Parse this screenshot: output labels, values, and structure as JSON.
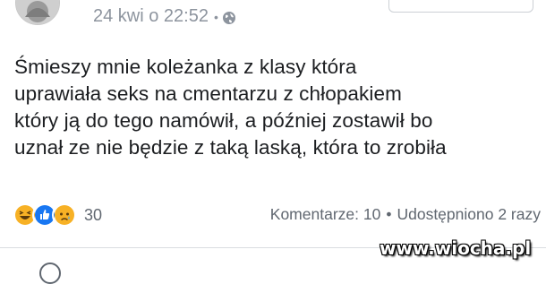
{
  "post": {
    "timestamp": "24 kwi o 22:52",
    "separator": "•",
    "privacy_icon": "globe-icon",
    "text": "Śmieszy mnie koleżanka z klasy która\nuprawiała seks na cmentarzu z chłopakiem\nktóry ją do tego namówił, a później  zostawił bo\nuznał ze nie będzie z taką laską, która to zrobiła"
  },
  "reactions": {
    "icons": [
      "haha-icon",
      "like-icon",
      "sad-icon"
    ],
    "count": "30"
  },
  "stats": {
    "comments": "Komentarze: 10",
    "separator": "•",
    "shares": "Udostępniono 2 razy"
  },
  "watermark": "www.wiocha.pl",
  "colors": {
    "meta_text": "#8d949e",
    "like_blue": "#1877f2",
    "reaction_yellow": "#f7b125",
    "divider": "#dadde1"
  }
}
